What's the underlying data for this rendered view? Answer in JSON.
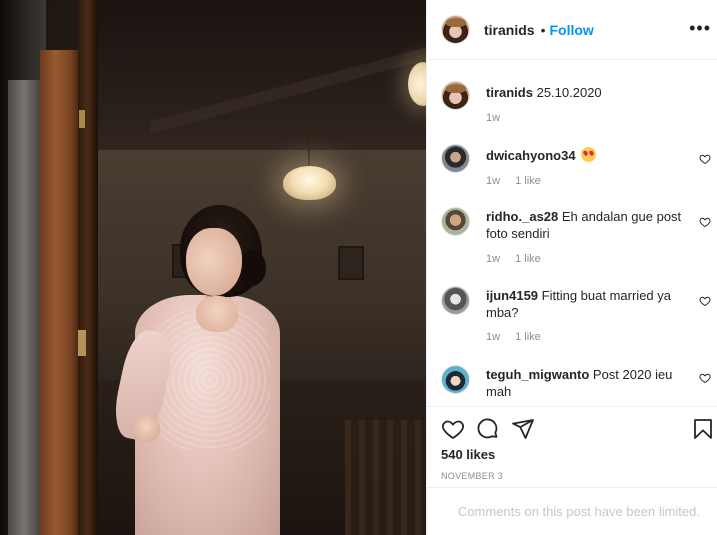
{
  "header": {
    "username": "tiranids",
    "separator": "•",
    "follow_label": "Follow",
    "more_icon": "ellipsis-icon"
  },
  "caption": {
    "username": "tiranids",
    "text": "25.10.2020",
    "time": "1w"
  },
  "comments": [
    {
      "username": "dwicahyono34",
      "text": "",
      "emoji": "heart-eyes-emoji",
      "time": "1w",
      "likes": "1 like"
    },
    {
      "username": "ridho._as28",
      "text": "Eh andalan gue post foto sendiri",
      "time": "1w",
      "likes": "1 like"
    },
    {
      "username": "ijun4159",
      "text": "Fitting buat married ya mba?",
      "time": "1w",
      "likes": "1 like"
    },
    {
      "username": "teguh_migwanto",
      "text": "Post 2020 ieu mah",
      "time": "",
      "likes": ""
    }
  ],
  "actions": {
    "like_icon": "heart-icon",
    "comment_icon": "comment-icon",
    "share_icon": "send-icon",
    "save_icon": "bookmark-icon"
  },
  "likes_count": "540 likes",
  "post_date": "NOVEMBER 3",
  "comments_limited": "Comments on this post have been limited.",
  "colors": {
    "follow_blue": "#0095f6",
    "text_primary": "#262626",
    "text_secondary": "#8e8e8e",
    "divider": "#efefef"
  }
}
